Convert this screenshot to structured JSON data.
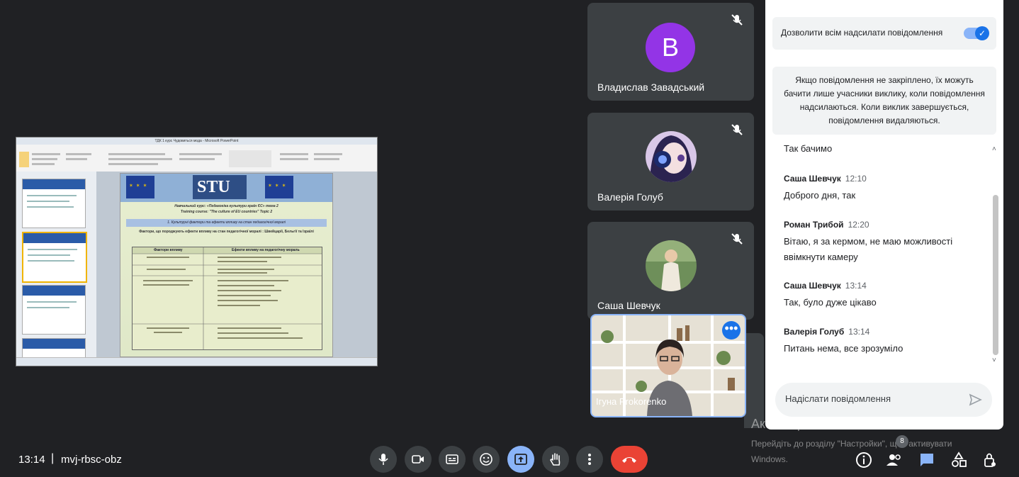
{
  "shared_screen": {
    "window_title": "ТДК 1 курс Чудовиться мода - Microsoft PowerPoint",
    "slide": {
      "course_ua": "Навчальний курс: «Педагогіка культури країн ЄС» тема 2",
      "course_en": "Training course: \"The culture of EU countries\" Topic 2",
      "section": "1. Культурні фактори та ефекти впливу на стан педагогічної моралі",
      "subtitle": "Фактори, що породжують ефекти впливу на стан педагогічної моралі : Швейцарії, Бельгії та Ізраїлі",
      "col1": "Фактори впливу",
      "col2": "Ефекти впливу на педагогічну мораль"
    }
  },
  "participants": [
    {
      "name": "Владислав Завадський",
      "initial": "B",
      "mic": "muted",
      "avatar_color": "#9334e6"
    },
    {
      "name": "Валерія Голуб",
      "mic": "muted"
    },
    {
      "name": "Саша Шевчук",
      "mic": "muted"
    },
    {
      "name": "Ігуна Prokorenko"
    }
  ],
  "chat": {
    "toggle_label": "Дозволити всім надсилати повідомлення",
    "toggle_on": true,
    "info_lines": [
      "Якщо повідомлення не закріплено, їх можуть",
      "бачити лише учасники виклику, коли повідомлення",
      "надсилаються. Коли виклик завершується,",
      "повідомлення видаляються."
    ],
    "messages": [
      {
        "sender": "",
        "time": "",
        "lines": [
          "Так бачимо"
        ]
      },
      {
        "sender": "Саша Шевчук",
        "time": "12:10",
        "lines": [
          "Доброго дня, так"
        ]
      },
      {
        "sender": "Роман Трибой",
        "time": "12:20",
        "lines": [
          "Вітаю, я за кермом, не маю можливості",
          "ввімкнути камеру"
        ]
      },
      {
        "sender": "Саша Шевчук",
        "time": "13:14",
        "lines": [
          "Так, було дуже цікаво"
        ]
      },
      {
        "sender": "Валерія Голуб",
        "time": "13:14",
        "lines": [
          "Питань нема, все зрозуміло"
        ]
      }
    ],
    "input_placeholder": "Надіслати повідомлення"
  },
  "watermark": {
    "title": "Активація Windows",
    "line1": "Перейдіть до розділу \"Настройки\", щоб активувати",
    "line2": "Windows."
  },
  "bottom_bar": {
    "time": "13:14",
    "separator": "|",
    "meeting_code": "mvj-rbsc-obz",
    "participant_count": "8",
    "accent": "#8ab4f8",
    "end_call_color": "#ea4335"
  }
}
